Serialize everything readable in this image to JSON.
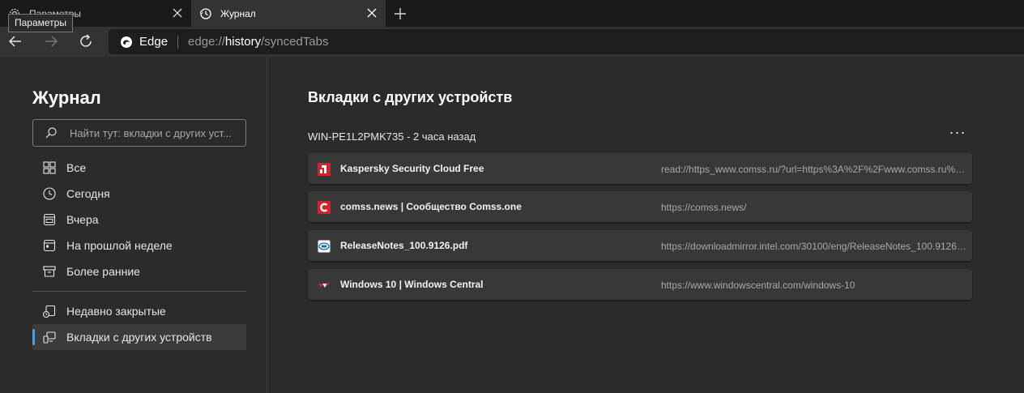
{
  "tabs": [
    {
      "label": "Параметры",
      "icon": "gear-icon",
      "active": false
    },
    {
      "label": "Журнал",
      "icon": "history-icon",
      "active": true
    }
  ],
  "tooltip": "Параметры",
  "address": {
    "brand": "Edge",
    "scheme": "edge://",
    "host": "history",
    "path": "/syncedTabs"
  },
  "sidebar": {
    "title": "Журнал",
    "search_placeholder": "Найти тут: вкладки с других уст...",
    "items": [
      {
        "label": "Все",
        "icon": "grid-icon"
      },
      {
        "label": "Сегодня",
        "icon": "clock-icon"
      },
      {
        "label": "Вчера",
        "icon": "calendar-day-icon"
      },
      {
        "label": "На прошлой неделе",
        "icon": "calendar-week-icon"
      },
      {
        "label": "Более ранние",
        "icon": "archive-icon"
      }
    ],
    "items2": [
      {
        "label": "Недавно закрытые",
        "icon": "recently-closed-icon"
      },
      {
        "label": "Вкладки с других устройств",
        "icon": "devices-icon",
        "selected": true
      }
    ]
  },
  "main": {
    "title": "Вкладки с других устройств",
    "device": "WIN-PE1L2PMK735 - 2 часа назад",
    "more_label": "···",
    "rows": [
      {
        "title": "Kaspersky Security Cloud Free",
        "url": "read://https_www.comss.ru/?url=https%3A%2F%2Fwww.comss.ru%2F...",
        "icon": "kaspersky-icon"
      },
      {
        "title": "comss.news | Сообщество Comss.one",
        "url": "https://comss.news/",
        "icon": "comss-icon"
      },
      {
        "title": "ReleaseNotes_100.9126.pdf",
        "url": "https://downloadmirror.intel.com/30100/eng/ReleaseNotes_100.9126....",
        "icon": "intel-icon"
      },
      {
        "title": "Windows 10 | Windows Central",
        "url": "https://www.windowscentral.com/windows-10",
        "icon": "windows-central-icon"
      }
    ]
  },
  "colors": {
    "accent": "#4aa0e6",
    "panel": "#2b2b2b",
    "card": "#383838",
    "kaspersky": "#d3222a",
    "comss": "#d3222a"
  }
}
